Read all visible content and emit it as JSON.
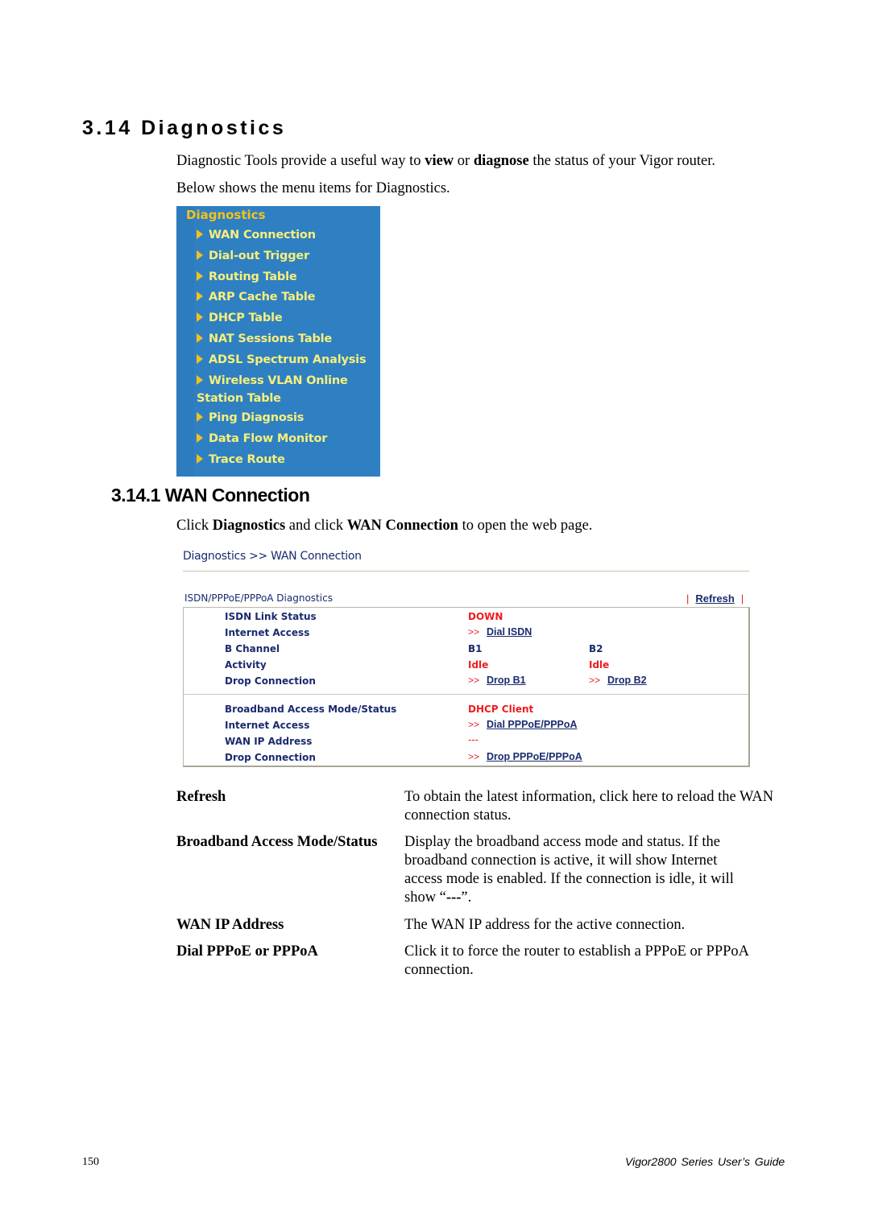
{
  "section": {
    "title": "3.14 Diagnostics",
    "intro": {
      "part1": "Diagnostic Tools provide a useful way to ",
      "bold1": "view",
      "part2": " or ",
      "bold2": "diagnose",
      "part3": " the status of your Vigor router."
    },
    "intro2": "Below shows the menu items for Diagnostics."
  },
  "menu": {
    "title": "Diagnostics",
    "items": [
      {
        "label": "WAN Connection"
      },
      {
        "label": "Dial-out Trigger"
      },
      {
        "label": "Routing Table"
      },
      {
        "label": "ARP Cache Table"
      },
      {
        "label": "DHCP Table"
      },
      {
        "label": "NAT Sessions Table"
      },
      {
        "label": "ADSL Spectrum Analysis"
      },
      {
        "label": "Wireless VLAN Online",
        "continuation": "Station Table"
      },
      {
        "label": "Ping Diagnosis"
      },
      {
        "label": "Data Flow Monitor"
      },
      {
        "label": "Trace Route"
      }
    ],
    "colors": {
      "background": "#2f80c2",
      "title": "#f4c21c",
      "item": "#f7ef7a"
    }
  },
  "subsection": {
    "title": "3.14.1 WAN Connection",
    "instruction": {
      "part1": "Click ",
      "bold1": "Diagnostics",
      "part2": " and click ",
      "bold2": "WAN Connection",
      "part3": " to open the web page."
    }
  },
  "webpage": {
    "breadcrumb": "Diagnostics >> WAN Connection",
    "caption": "ISDN/PPPoE/PPPoA Diagnostics",
    "refresh_label": "Refresh",
    "separator": "|",
    "isdn": {
      "link_status_label": "ISDN Link Status",
      "link_status_value": "DOWN",
      "internet_access_label": "Internet Access",
      "dial_isdn": "Dial ISDN",
      "b_channel_label": "B Channel",
      "b1": "B1",
      "b2": "B2",
      "activity_label": "Activity",
      "activity_b1": "Idle",
      "activity_b2": "Idle",
      "drop_label": "Drop Connection",
      "drop_b1": "Drop B1",
      "drop_b2": "Drop B2"
    },
    "broadband": {
      "mode_label": "Broadband Access Mode/Status",
      "mode_value": "DHCP Client",
      "internet_access_label": "Internet Access",
      "dial_pppoe": "Dial PPPoE/PPPoA",
      "wan_ip_label": "WAN IP Address",
      "wan_ip_value": "---",
      "drop_label": "Drop Connection",
      "drop_pppoe": "Drop PPPoE/PPPoA"
    },
    "arrow": ">>",
    "colors": {
      "text": "#1a2b6e",
      "alert": "#ee1b1b"
    }
  },
  "definitions": [
    {
      "term": "Refresh",
      "desc": "To obtain the latest information, click here to reload the WAN connection status."
    },
    {
      "term": "Broadband Access Mode/Status",
      "desc_part1": "Display the broadband access mode and status. If the broadband connection is active, it will show Internet access mode is enabled. If the connection is idle, it will show “",
      "desc_bold": "---",
      "desc_part2": "”."
    },
    {
      "term": "WAN IP Address",
      "desc": "The WAN IP address for the active connection."
    },
    {
      "term": "Dial PPPoE or PPPoA",
      "desc": "Click it to force the router to establish a PPPoE or PPPoA connection."
    }
  ],
  "footer": {
    "page_number": "150",
    "guide_title": "Vigor2800 Series User’s Guide"
  }
}
